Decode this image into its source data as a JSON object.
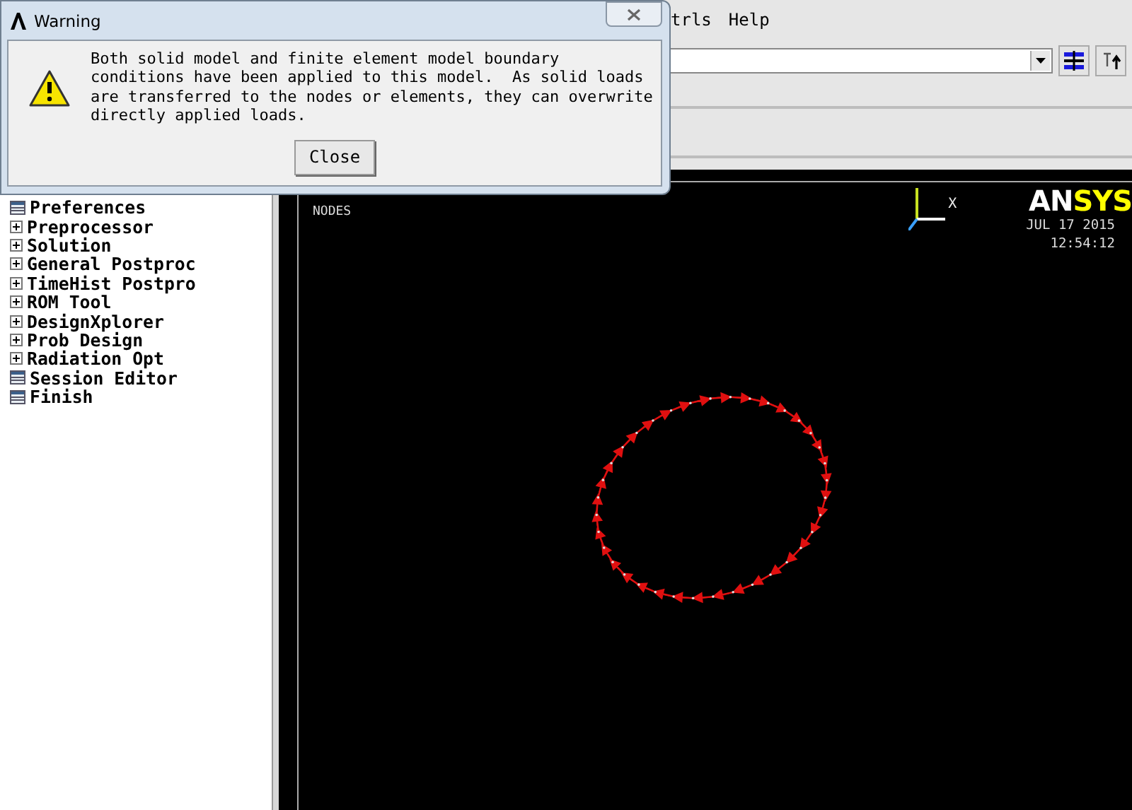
{
  "main_window": {
    "menu": [
      {
        "label": "trls"
      },
      {
        "label": "Help"
      }
    ],
    "tree": [
      {
        "label": "Preferences",
        "kind": "leaf"
      },
      {
        "label": "Preprocessor",
        "kind": "folder"
      },
      {
        "label": "Solution",
        "kind": "folder"
      },
      {
        "label": "General Postproc",
        "kind": "folder"
      },
      {
        "label": "TimeHist Postpro",
        "kind": "folder"
      },
      {
        "label": "ROM Tool",
        "kind": "folder"
      },
      {
        "label": "DesignXplorer",
        "kind": "folder"
      },
      {
        "label": "Prob Design",
        "kind": "folder"
      },
      {
        "label": "Radiation Opt",
        "kind": "folder"
      },
      {
        "label": "Session Editor",
        "kind": "leaf"
      },
      {
        "label": "Finish",
        "kind": "leaf"
      }
    ],
    "graphics": {
      "plot_label": "NODES",
      "axis_label": "X",
      "logo": [
        "AN",
        "SYS"
      ],
      "date": "JUL 17 2015",
      "time": "12:54:12"
    }
  },
  "dialog": {
    "title": "Warning",
    "message": "Both solid model and finite element model boundary\nconditions have been applied to this model.  As solid loads\nare transferred to the nodes or elements, they can overwrite\ndirectly applied loads.",
    "button": "Close"
  }
}
